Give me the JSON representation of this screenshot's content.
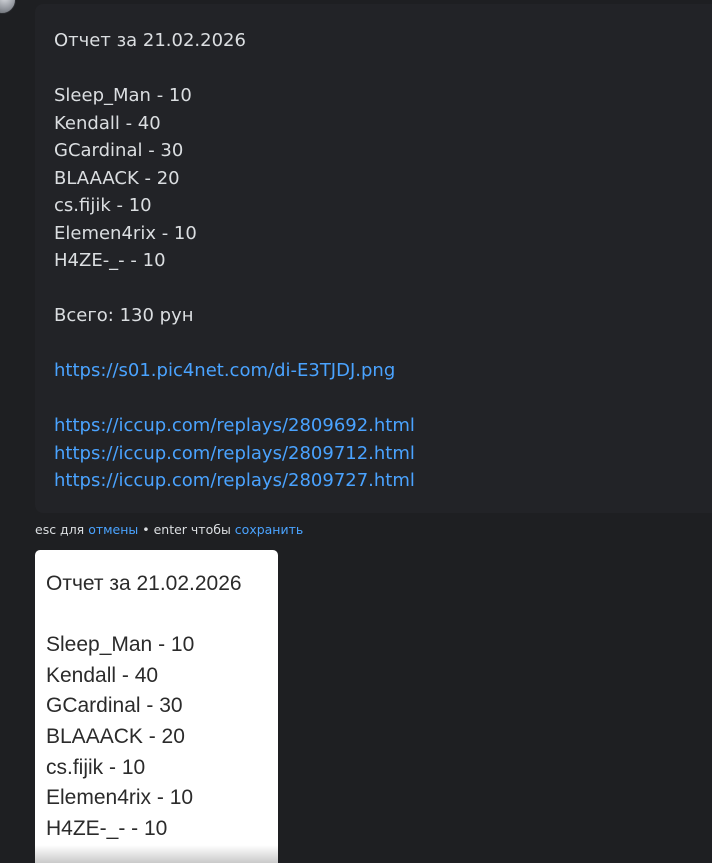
{
  "message": {
    "lines": [
      "Отчет за 21.02.2026",
      "",
      "Sleep_Man - 10",
      "Kendall - 40",
      "GCardinal - 30",
      "BLAAACK - 20",
      "cs.fijik - 10",
      "Elemen4rix - 10",
      "H4ZE-_- - 10",
      "",
      "Всего: 130 рун",
      ""
    ],
    "links": [
      "https://s01.pic4net.com/di-E3TJDJ.png",
      "",
      "https://iccup.com/replays/2809692.html",
      "https://iccup.com/replays/2809712.html",
      "https://iccup.com/replays/2809727.html"
    ]
  },
  "hint": {
    "esc_prefix": "esc для ",
    "cancel": "отмены",
    "middle": " • enter чтобы ",
    "save": "сохранить"
  },
  "embed": {
    "lines": [
      "Отчет за 21.02.2026",
      "",
      "Sleep_Man - 10",
      "Kendall - 40",
      "GCardinal - 30",
      "BLAAACK - 20",
      "cs.fijik - 10",
      "Elemen4rix - 10",
      "H4ZE-_- - 10"
    ]
  },
  "colors": {
    "background": "#1e1f22",
    "editor": "#222327",
    "text": "#dbdee1",
    "link": "#4aa3ff"
  }
}
